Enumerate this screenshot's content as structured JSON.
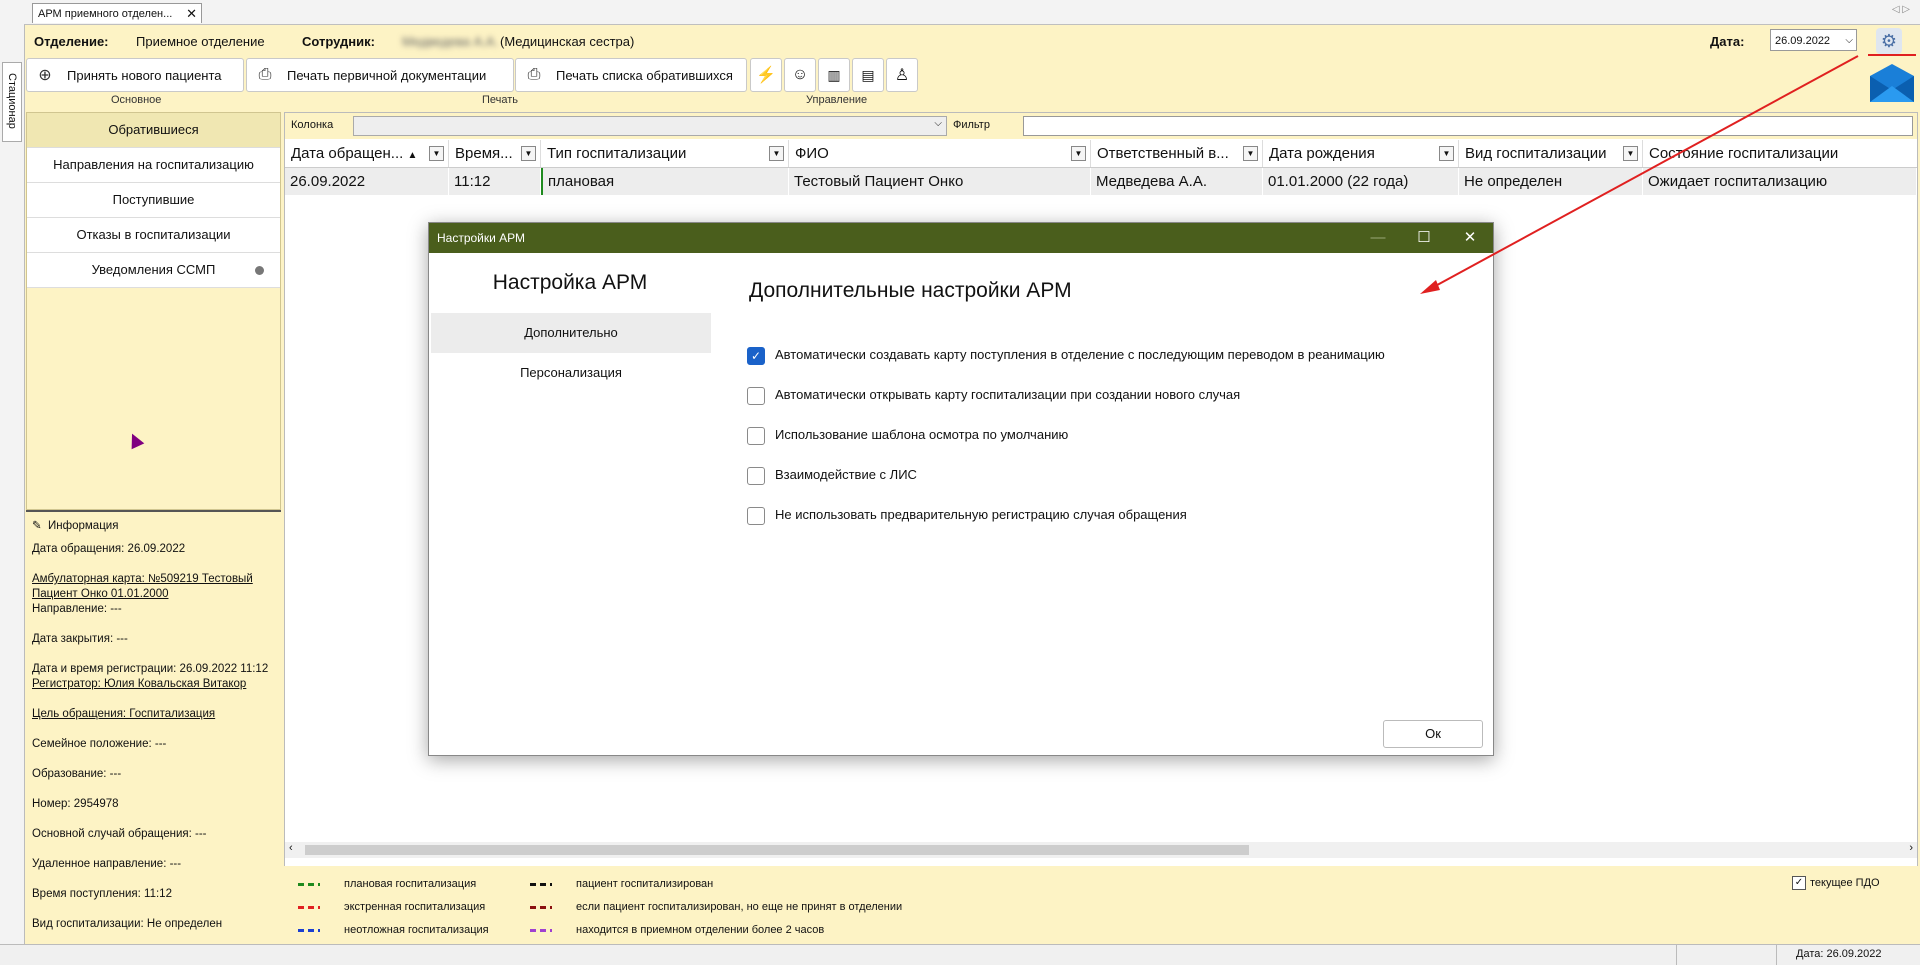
{
  "left_strip": {
    "tab_label": "Стационар"
  },
  "doc_tab": {
    "title": "АРМ приемного отделен...",
    "close": "✕"
  },
  "header": {
    "department_label": "Отделение:",
    "department_value": "Приемное отделение",
    "employee_label": "Сотрудник:",
    "employee_name": "Медведева А.А.",
    "employee_role": "(Медицинская сестра)",
    "date_label": "Дата:",
    "date_value": "26.09.2022"
  },
  "toolbar": {
    "new_patient": "Принять нового пациента",
    "print_primary": "Печать первичной документации",
    "print_list": "Печать списка обратившихся",
    "groups": {
      "basic": "Основное",
      "print": "Печать",
      "manage": "Управление"
    }
  },
  "leftnav": {
    "items": [
      {
        "label": "Обратившиеся"
      },
      {
        "label": "Направления на госпитализацию"
      },
      {
        "label": "Поступившие"
      },
      {
        "label": "Отказы в госпитализации"
      },
      {
        "label": "Уведомления ССМП"
      }
    ]
  },
  "info": {
    "title": "Информация",
    "lines": [
      "Дата обращения: 26.09.2022",
      "Амбулаторная карта: №509219 Тестовый Пациент Онко 01.01.2000",
      "Направление: ---",
      "Дата закрытия: ---",
      "Дата и время регистрации: 26.09.2022 11:12",
      "Регистратор: Юлия Ковальская Витакор",
      "Цель обращения: Госпитализация",
      "Семейное положение: ---",
      "Образование: ---",
      "Номер: 2954978",
      "Основной случай обращения: ---",
      "Удаленное направление: ---",
      "Время поступления: 11:12",
      "Вид госпитализации: Не определен"
    ]
  },
  "filterbar": {
    "column_label": "Колонка",
    "filter_label": "Фильтр"
  },
  "table": {
    "columns": [
      "Дата обращен...",
      "Время...",
      "Тип госпитализации",
      "ФИО",
      "Ответственный в...",
      "Дата рождения",
      "Вид госпитализации",
      "Состояние госпитализации"
    ],
    "rows": [
      [
        "26.09.2022",
        "11:12",
        "плановая",
        "Тестовый Пациент Онко",
        "Медведева А.А.",
        "01.01.2000 (22 года)",
        "Не определен",
        "Ожидает госпитализацию"
      ]
    ]
  },
  "legend": {
    "items": [
      {
        "label": "плановая госпитализация",
        "color": "#1e8a1e"
      },
      {
        "label": "экстренная госпитализация",
        "color": "#e02020"
      },
      {
        "label": "неотложная госпитализация",
        "color": "#1a3fd0"
      },
      {
        "label": "пациент госпитализирован",
        "color": "#111111"
      },
      {
        "label": "если пациент госпитализирован, но еще не принят в  отделении",
        "color": "#8b1010"
      },
      {
        "label": "находится в приемном отделении более 2 часов",
        "color": "#a040d0"
      }
    ],
    "current_pdo": "текущее ПДО"
  },
  "statusbar": {
    "date": "Дата: 26.09.2022"
  },
  "dialog": {
    "title": "Настройки АРМ",
    "side_title": "Настройка АРМ",
    "side_items": [
      "Дополнительно",
      "Персонализация"
    ],
    "main_title": "Дополнительные настройки АРМ",
    "options": [
      {
        "label": "Автоматически создавать карту поступления в отделение с последующим переводом в реанимацию",
        "checked": true
      },
      {
        "label": "Автоматически открывать карту госпитализации при создании нового случая",
        "checked": false
      },
      {
        "label": "Использование шаблона осмотра по умолчанию",
        "checked": false
      },
      {
        "label": "Взаимодействие с ЛИС",
        "checked": false
      },
      {
        "label": "Не использовать предварительную регистрацию случая обращения",
        "checked": false
      }
    ],
    "ok": "Ок"
  },
  "colors": {
    "accent_bg": "#fdf3c5",
    "dialog_title_bg": "#4a5e1c",
    "checkbox_on": "#1a62c9",
    "annotation": "#e02020"
  }
}
